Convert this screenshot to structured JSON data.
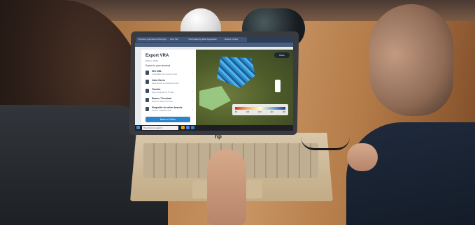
{
  "scene": {
    "description_labels": {
      "laptop_brand": "hp"
    }
  },
  "screen": {
    "tabs": [
      "Precision Agriculture Web App - ...",
      "New Tab",
      "Yield Mapping Web Application",
      "Report a Field"
    ],
    "panel": {
      "title": "Export VRA",
      "subtitle": "Wheat • 85ha",
      "section": "Export to your terminal",
      "options": [
        {
          "label": "ISO XML",
          "desc": "Compatible with most terminals"
        },
        {
          "label": "John Deere",
          "desc": "Send directly to operations center"
        },
        {
          "label": "Trimble",
          "desc": "Export shapefile for Trimble"
        },
        {
          "label": "Raven / Terminal",
          "desc": "Export for Raven terminal"
        },
        {
          "label": "Shapefile for other brands",
          "desc": "Generic shapefile export"
        }
      ],
      "back_button": "Back to Fields"
    },
    "map": {
      "button": "Done",
      "legend_values": [
        "80",
        "100",
        "120",
        "140",
        "160"
      ]
    },
    "taskbar": {
      "search_placeholder": "Type here to search"
    }
  },
  "colors": {
    "accent": "#2f83c9",
    "tabbar": "#2c3d55",
    "field_highlight": "#9fd08a"
  }
}
